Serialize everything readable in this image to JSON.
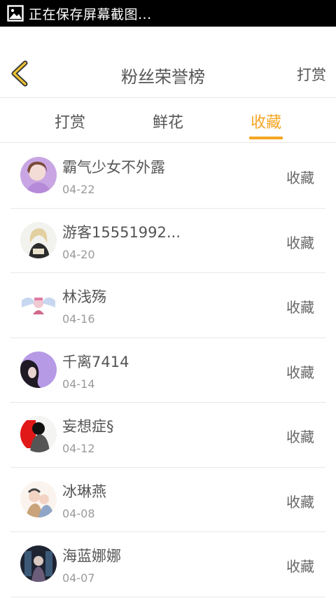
{
  "status_bar": {
    "text": "正在保存屏幕截图...",
    "icon": "image-icon"
  },
  "header": {
    "back_icon": "chevron-left-icon",
    "title": "粉丝荣誉榜",
    "right_action": "打赏"
  },
  "tabs": [
    {
      "label": "打赏",
      "active": false
    },
    {
      "label": "鲜花",
      "active": false
    },
    {
      "label": "收藏",
      "active": true
    }
  ],
  "colors": {
    "accent": "#f5a623",
    "text": "#555555",
    "muted": "#9a9a9a",
    "status_bar": "#000000"
  },
  "fans": [
    {
      "name": "霸气少女不外露",
      "date": "04-22",
      "action": "收藏",
      "avatar": "avatar-girl-purple"
    },
    {
      "name": "游客15551992...",
      "date": "04-20",
      "action": "收藏",
      "avatar": "avatar-girl-blonde"
    },
    {
      "name": "林浅殇",
      "date": "04-16",
      "action": "收藏",
      "avatar": "avatar-anime-wings"
    },
    {
      "name": "千离7414",
      "date": "04-14",
      "action": "收藏",
      "avatar": "avatar-girl-lavender"
    },
    {
      "name": "妄想症§",
      "date": "04-12",
      "action": "收藏",
      "avatar": "avatar-red-silhouette"
    },
    {
      "name": "冰琳燕",
      "date": "04-08",
      "action": "收藏",
      "avatar": "avatar-anime-pair"
    },
    {
      "name": "海蓝娜娜",
      "date": "04-07",
      "action": "收藏",
      "avatar": "avatar-dark-illustration"
    }
  ]
}
